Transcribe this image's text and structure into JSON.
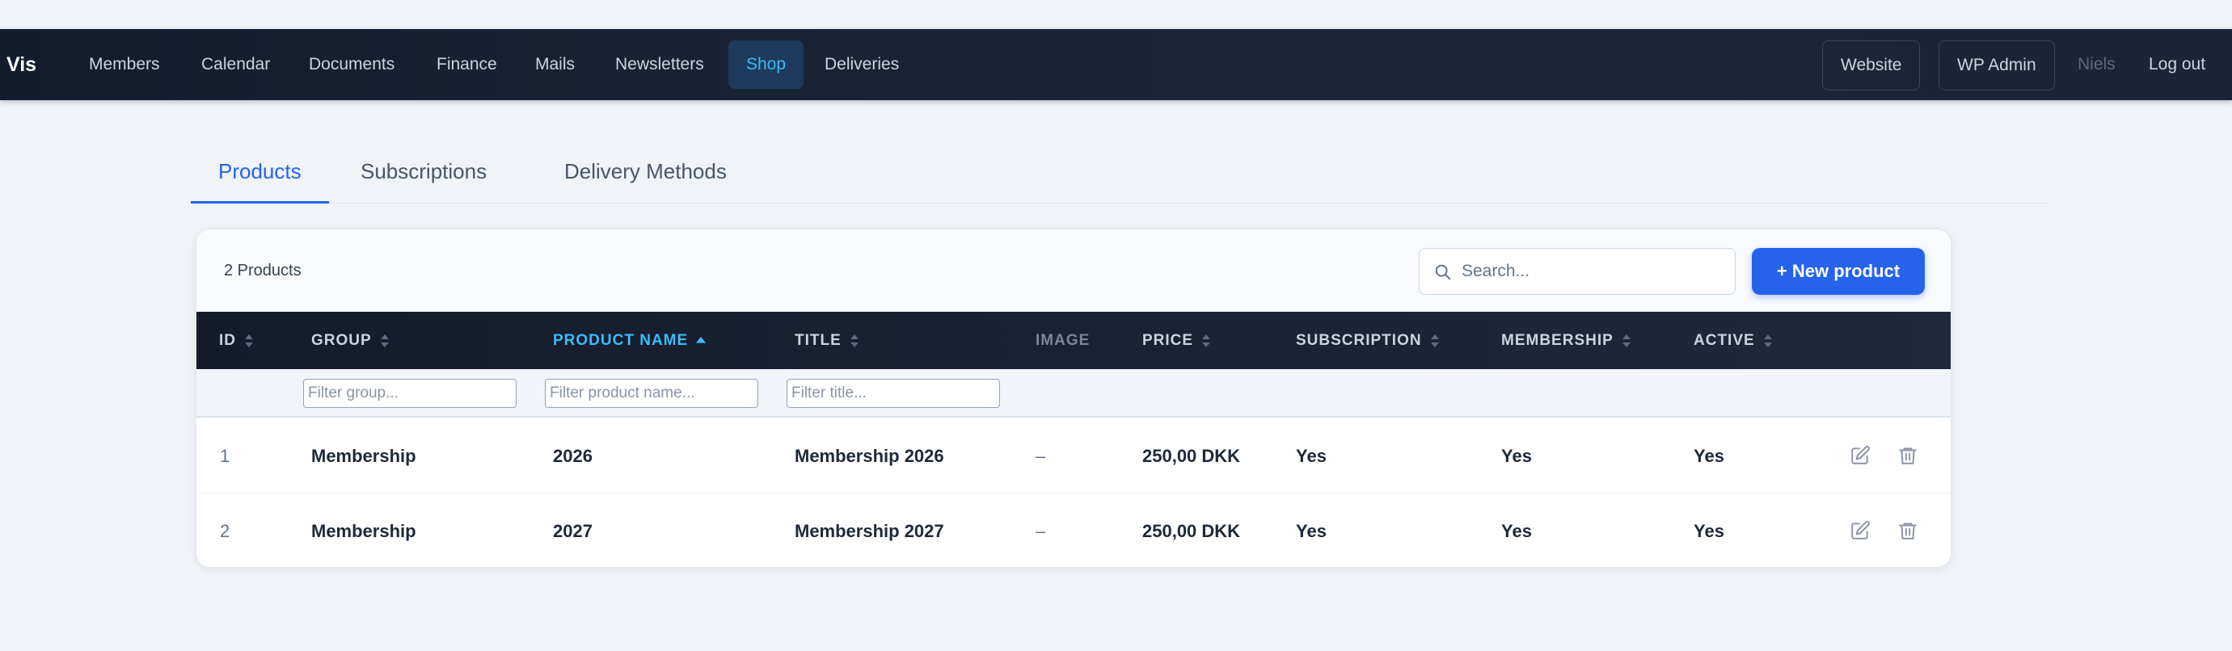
{
  "nav": {
    "brand": "Vis",
    "items": [
      {
        "label": "Members"
      },
      {
        "label": "Calendar"
      },
      {
        "label": "Documents"
      },
      {
        "label": "Finance"
      },
      {
        "label": "Mails"
      },
      {
        "label": "Newsletters"
      },
      {
        "label": "Shop",
        "active": true
      },
      {
        "label": "Deliveries"
      }
    ],
    "website_label": "Website",
    "wpadmin_label": "WP Admin",
    "user": "Niels",
    "logout_label": "Log out"
  },
  "tabs": [
    {
      "label": "Products",
      "active": true
    },
    {
      "label": "Subscriptions"
    },
    {
      "label": "Delivery Methods"
    }
  ],
  "toolbar": {
    "count_text": "2 Products",
    "search_placeholder": "Search...",
    "new_button_label": "+ New product"
  },
  "table": {
    "columns": [
      {
        "label": "ID",
        "sortable": true
      },
      {
        "label": "GROUP",
        "sortable": true
      },
      {
        "label": "PRODUCT NAME",
        "sortable": true,
        "sorted": "asc"
      },
      {
        "label": "TITLE",
        "sortable": true
      },
      {
        "label": "IMAGE",
        "sortable": false
      },
      {
        "label": "PRICE",
        "sortable": true
      },
      {
        "label": "SUBSCRIPTION",
        "sortable": true
      },
      {
        "label": "MEMBERSHIP",
        "sortable": true
      },
      {
        "label": "ACTIVE",
        "sortable": true
      }
    ],
    "filters": {
      "group_placeholder": "Filter group...",
      "product_name_placeholder": "Filter product name...",
      "title_placeholder": "Filter title..."
    },
    "rows": [
      {
        "id": "1",
        "group": "Membership",
        "product_name": "2026",
        "title": "Membership 2026",
        "image": "–",
        "price": "250,00 DKK",
        "subscription": "Yes",
        "membership": "Yes",
        "active": "Yes"
      },
      {
        "id": "2",
        "group": "Membership",
        "product_name": "2027",
        "title": "Membership 2027",
        "image": "–",
        "price": "250,00 DKK",
        "subscription": "Yes",
        "membership": "Yes",
        "active": "Yes"
      }
    ]
  },
  "colors": {
    "accent": "#2563eb",
    "active_nav": "#38bdf8",
    "nav_bg": "#141b2d"
  },
  "icons": {
    "search": "search-icon",
    "sort": "sort-icon",
    "sort_asc": "sort-asc-icon",
    "edit": "edit-icon",
    "delete": "trash-icon"
  }
}
